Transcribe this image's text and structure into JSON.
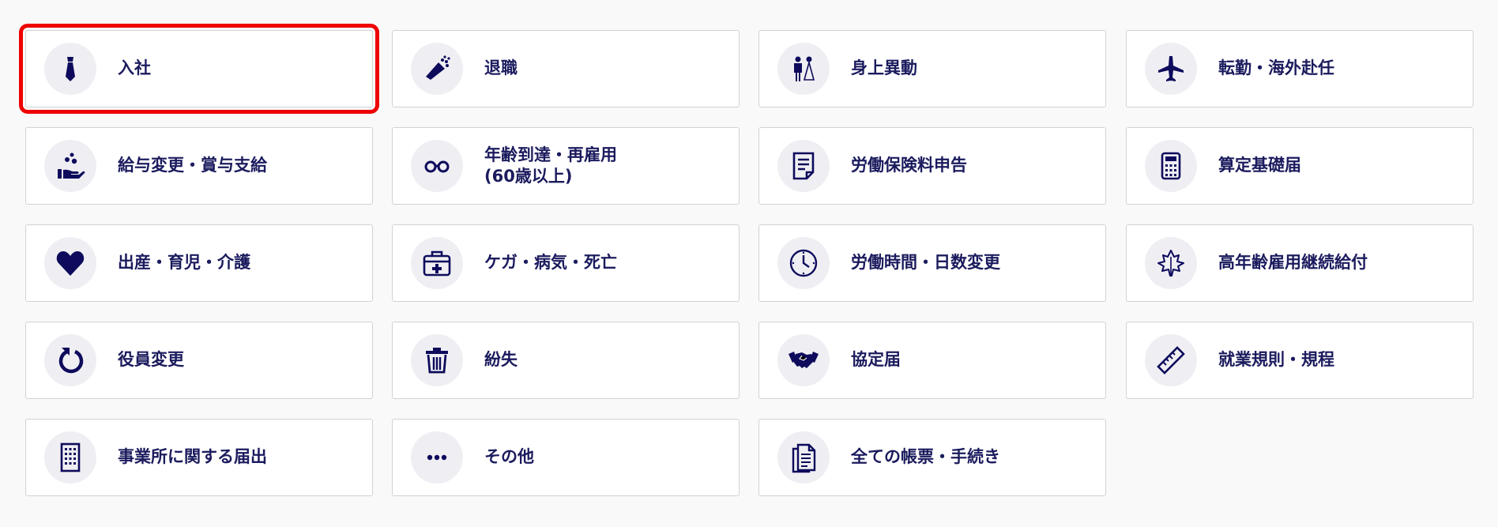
{
  "colors": {
    "accent": "#0e0b5c",
    "highlight": "#ef0000",
    "card_border": "#d2d2d2",
    "icon_bg": "#efeff3"
  },
  "items": [
    {
      "label": "入社",
      "icon": "necktie-icon"
    },
    {
      "label": "退職",
      "icon": "bouquet-icon"
    },
    {
      "label": "身上異動",
      "icon": "wedding-couple-icon"
    },
    {
      "label": "転勤・海外赴任",
      "icon": "airplane-icon"
    },
    {
      "label": "給与変更・賞与支給",
      "icon": "coins-hand-icon"
    },
    {
      "label": "年齢到達・再雇用\n(60歳以上)",
      "icon": "glasses-icon"
    },
    {
      "label": "労働保険料申告",
      "icon": "document-icon"
    },
    {
      "label": "算定基礎届",
      "icon": "calculator-icon"
    },
    {
      "label": "出産・育児・介護",
      "icon": "heart-icon"
    },
    {
      "label": "ケガ・病気・死亡",
      "icon": "first-aid-kit-icon"
    },
    {
      "label": "労働時間・日数変更",
      "icon": "clock-icon"
    },
    {
      "label": "高年齢雇用継続給付",
      "icon": "maple-leaf-icon"
    },
    {
      "label": "役員変更",
      "icon": "refresh-icon"
    },
    {
      "label": "紛失",
      "icon": "trash-icon"
    },
    {
      "label": "協定届",
      "icon": "handshake-icon"
    },
    {
      "label": "就業規則・規程",
      "icon": "ruler-icon"
    },
    {
      "label": "事業所に関する届出",
      "icon": "building-icon"
    },
    {
      "label": "その他",
      "icon": "more-icon"
    },
    {
      "label": "全ての帳票・手続き",
      "icon": "documents-icon"
    }
  ]
}
